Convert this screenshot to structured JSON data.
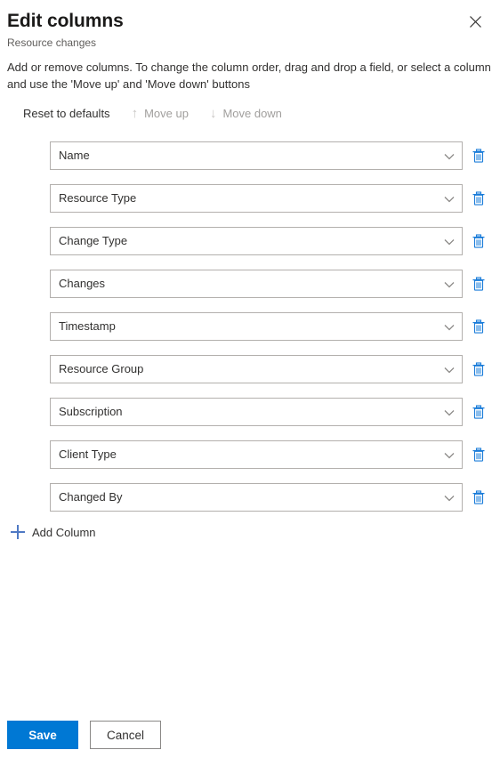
{
  "panel": {
    "title": "Edit columns",
    "subtitle": "Resource changes",
    "close_icon": "close-icon",
    "description": "Add or remove columns. To change the column order, drag and drop a field, or select a column and use the 'Move up' and 'Move down' buttons"
  },
  "commandbar": {
    "reset_label": "Reset to defaults",
    "move_up_label": "Move up",
    "move_up_icon": "arrow-up-icon",
    "move_up_glyph": "↑",
    "move_down_label": "Move down",
    "move_down_icon": "arrow-down-icon",
    "move_down_glyph": "↓"
  },
  "columns": [
    {
      "label": "Name"
    },
    {
      "label": "Resource Type"
    },
    {
      "label": "Change Type"
    },
    {
      "label": "Changes"
    },
    {
      "label": "Timestamp"
    },
    {
      "label": "Resource Group"
    },
    {
      "label": "Subscription"
    },
    {
      "label": "Client Type"
    },
    {
      "label": "Changed By"
    }
  ],
  "add_column": {
    "label": "Add Column",
    "icon": "plus-icon"
  },
  "footer": {
    "save_label": "Save",
    "cancel_label": "Cancel"
  },
  "colors": {
    "accent": "#0078d4",
    "delete_icon": "#1a7cd9",
    "plus_icon": "#4f79c4",
    "text": "#323130",
    "muted_text": "#605e5c",
    "disabled_text": "#a19f9d",
    "border": "#b3b0ad"
  }
}
